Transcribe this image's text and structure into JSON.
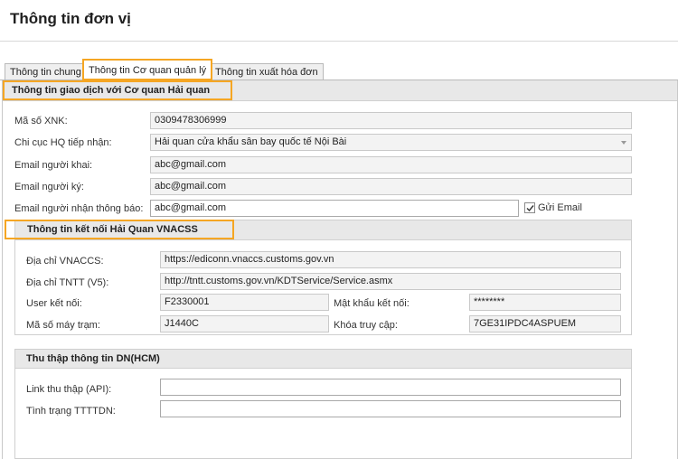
{
  "window": {
    "title": "Thông tin đơn vị"
  },
  "tabs": [
    {
      "label": "Thông tin chung"
    },
    {
      "label": "Thông tin Cơ quan quản lý"
    },
    {
      "label": "Thông tin xuất hóa đơn"
    }
  ],
  "section_customs": {
    "title": "Thông tin giao dịch với Cơ quan Hải quan",
    "ma_so_xnk": {
      "label": "Mã số XNK:",
      "value": "0309478306999"
    },
    "chi_cuc": {
      "label": "Chi cục HQ tiếp nhận:",
      "value": "Hải quan cửa khẩu sân bay quốc tế Nội Bài"
    },
    "email_khai": {
      "label": "Email người khai:",
      "value": "abc@gmail.com"
    },
    "email_ky": {
      "label": "Email người ký:",
      "value": "abc@gmail.com"
    },
    "email_nhan": {
      "label": "Email người nhận thông báo:",
      "value": "abc@gmail.com"
    },
    "gui_email": {
      "label": "Gửi Email",
      "checked": true
    }
  },
  "section_vnaccs": {
    "title": "Thông tin kết nối Hải Quan VNACSS",
    "vnaccs": {
      "label": "Địa chỉ VNACCS:",
      "value": "https://ediconn.vnaccs.customs.gov.vn"
    },
    "tntt": {
      "label": "Địa chỉ TNTT (V5):",
      "value": "http://tntt.customs.gov.vn/KDTService/Service.asmx"
    },
    "user": {
      "label": "User kết nối:",
      "value": "F2330001"
    },
    "password": {
      "label": "Mật khẩu kết nối:",
      "value": "********"
    },
    "ma_may_tram": {
      "label": "Mã số máy trạm:",
      "value": "J1440C"
    },
    "khoa_truy_cap": {
      "label": "Khóa truy cập:",
      "value": "7GE31IPDC4ASPUEM"
    }
  },
  "section_dn": {
    "title": "Thu thập thông tin DN(HCM)",
    "link_api": {
      "label": "Link thu thập (API):",
      "value": ""
    },
    "tinh_trang": {
      "label": "Tình trạng TTTTDN:",
      "value": ""
    }
  },
  "colors": {
    "highlight": "#f5a623",
    "section_header": "#e8e8e8",
    "readonly_field": "#f3f3f3"
  }
}
